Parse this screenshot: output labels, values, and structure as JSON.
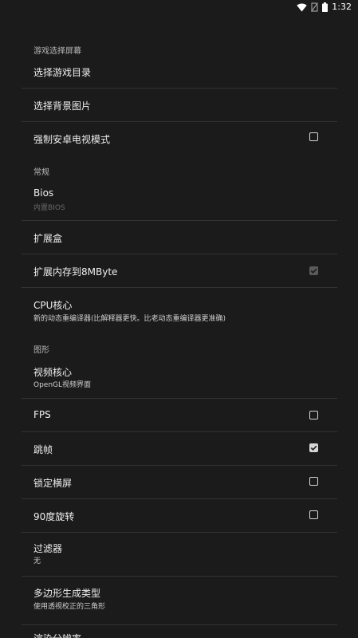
{
  "status_bar": {
    "time": "1:32",
    "icons": [
      "wifi-icon",
      "no-sim-icon",
      "battery-icon"
    ]
  },
  "sections": {
    "game_select": "游戏选择屏幕",
    "general": "常规",
    "graphics": "图形"
  },
  "settings": {
    "choose_game_dir": {
      "title": "选择游戏目录"
    },
    "choose_background": {
      "title": "选择背景图片"
    },
    "force_tv_mode": {
      "title": "强制安卓电视模式",
      "checked": false
    },
    "bios": {
      "title": "Bios",
      "subtitle": "内置BIOS"
    },
    "expansion_box": {
      "title": "扩展盒"
    },
    "expand_memory": {
      "title": "扩展内存到8MByte",
      "checked": true,
      "enabled": false
    },
    "cpu_core": {
      "title": "CPU核心",
      "subtitle": "新的动态重编译器(比解释器更快。比老动态重编译器更准确)"
    },
    "video_core": {
      "title": "视频核心",
      "subtitle": "OpenGL视频界面"
    },
    "fps": {
      "title": "FPS",
      "checked": false
    },
    "frame_skip": {
      "title": "跳帧",
      "checked": true
    },
    "lock_landscape": {
      "title": "锁定横屏",
      "checked": false
    },
    "rotate_90": {
      "title": "90度旋转",
      "checked": false
    },
    "filter": {
      "title": "过滤器",
      "subtitle": "无"
    },
    "polygon_type": {
      "title": "多边形生成类型",
      "subtitle": "使用透视校正的三角形"
    },
    "render_resolution": {
      "title": "渲染分辨率"
    }
  },
  "colors": {
    "background": "#1b1b1b",
    "text_primary": "#efefef",
    "text_secondary": "#cfcfcf",
    "section_header": "#b8b8b8",
    "divider": "#333333",
    "checkbox": "#d6d6d6",
    "checkbox_disabled": "#5a5a5a"
  }
}
